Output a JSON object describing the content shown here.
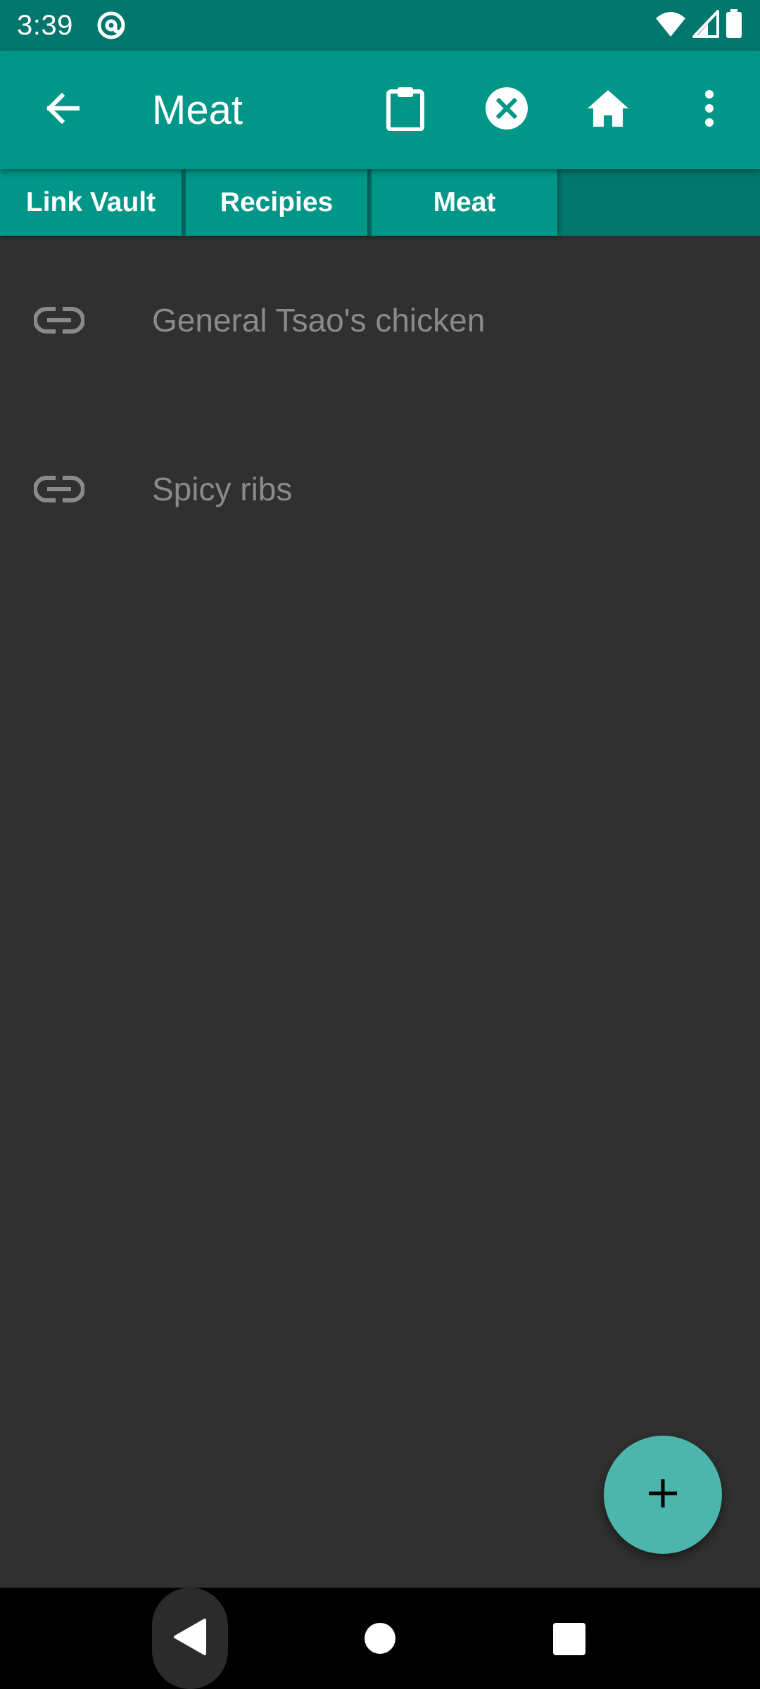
{
  "status_bar": {
    "time": "3:39",
    "app_icon": "at-sign-icon",
    "icons": [
      "wifi-icon",
      "signal-icon",
      "battery-icon"
    ]
  },
  "app_bar": {
    "title": "Meat",
    "back_icon": "arrow-back-icon",
    "actions": [
      "clipboard-icon",
      "close-circle-icon",
      "home-icon",
      "more-vert-icon"
    ]
  },
  "tabs": [
    {
      "label": "Link Vault"
    },
    {
      "label": "Recipies"
    },
    {
      "label": "Meat"
    }
  ],
  "items": [
    {
      "label": "General Tsao's chicken",
      "icon": "link-icon"
    },
    {
      "label": "Spicy ribs",
      "icon": "link-icon"
    }
  ],
  "fab": {
    "icon": "plus-icon"
  },
  "nav_bar": {
    "icons": [
      "nav-back-icon",
      "nav-home-icon",
      "nav-recents-icon"
    ]
  },
  "colors": {
    "primary": "#009688",
    "primary_dark": "#00766C",
    "fab": "#4DB6AC",
    "background": "#303030",
    "item_text": "#8A8A8A"
  }
}
